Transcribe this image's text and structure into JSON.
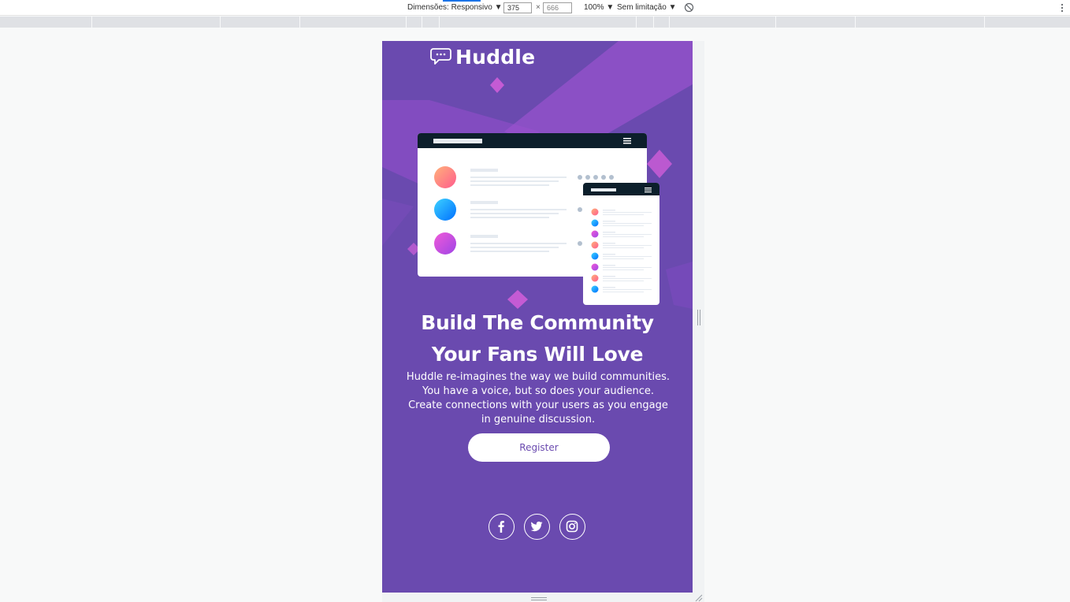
{
  "devtools": {
    "dimensions_label": "Dimensões: Responsivo ▼",
    "width_value": "375",
    "height_value": "666",
    "x_sep": "×",
    "zoom_label": "100% ▼",
    "throttle_label": "Sem limitação ▼"
  },
  "page": {
    "brand": "Huddle",
    "headline_line1": "Build The Community",
    "headline_line2": "Your Fans Will Love",
    "subtext": "Huddle re-imagines the way we build communities. You have a voice, but so does your audience. Create connections with your users as you engage in genuine discussion.",
    "register_label": "Register",
    "social_icons": [
      "facebook-icon",
      "twitter-icon",
      "instagram-icon"
    ]
  },
  "colors": {
    "background_violet": "#6a4aaf",
    "accent_magenta": "#c45bd4",
    "white": "#ffffff"
  }
}
